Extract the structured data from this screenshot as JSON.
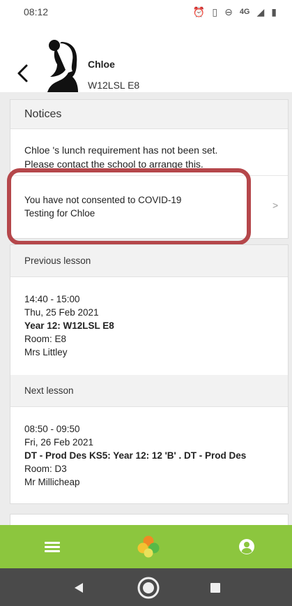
{
  "status_bar": {
    "time": "08:12",
    "network": "4G"
  },
  "header": {
    "child_name": "Chloe",
    "child_class": "W12LSL E8"
  },
  "notices": {
    "title": "Notices",
    "lunch_line1": "Chloe        's lunch requirement has not been set.",
    "lunch_line2": "Please contact the school to arrange this.",
    "covid_line1": "You have not consented to COVID-19",
    "covid_line2": "Testing for Chloe"
  },
  "previous_lesson": {
    "title": "Previous lesson",
    "time": "14:40 - 15:00",
    "date": "Thu, 25 Feb 2021",
    "subject": "Year 12: W12LSL E8",
    "room": "Room: E8",
    "teacher": "Mrs Littley"
  },
  "next_lesson": {
    "title": "Next lesson",
    "time": "08:50 - 09:50",
    "date": "Fri, 26 Feb 2021",
    "subject": "DT - Prod Des KS5: Year 12: 12 'B' . DT - Prod Des",
    "room": "Room: D3",
    "teacher": "Mr Millicheap"
  },
  "colors": {
    "nav_green": "#8cc63e",
    "highlight_red": "#b5474b",
    "android_nav": "#4a4a4a"
  },
  "icons": [
    "back-arrow-icon",
    "menu-icon",
    "app-logo-icon",
    "account-icon",
    "chevron-right-icon"
  ]
}
